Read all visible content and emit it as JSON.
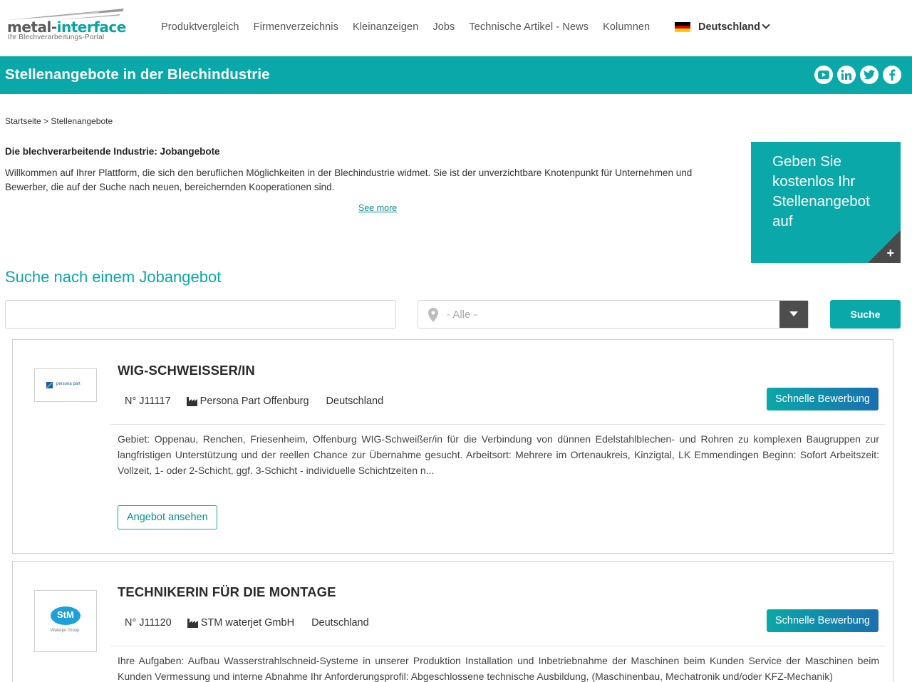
{
  "header": {
    "logo_main": "metal-",
    "logo_accent": "interface",
    "logo_tagline": "Ihr Blechverarbeitungs-Portal",
    "nav": [
      {
        "label": "Produktvergleich"
      },
      {
        "label": "Firmenverzeichnis"
      },
      {
        "label": "Kleinanzeigen"
      },
      {
        "label": "Jobs"
      },
      {
        "label": "Technische Artikel - News"
      },
      {
        "label": "Kolumnen"
      }
    ],
    "country": "Deutschland"
  },
  "band": {
    "title": "Stellenangebote in der Blechindustrie",
    "social_icons": [
      "youtube-icon",
      "linkedin-icon",
      "twitter-icon",
      "facebook-icon"
    ]
  },
  "breadcrumb": {
    "home": "Startseite",
    "separator": ">",
    "current": "Stellenangebote"
  },
  "intro": {
    "title": "Die blechverarbeitende Industrie: Jobangebote",
    "text": "Willkommen auf Ihrer Plattform, die sich den beruflichen Möglichkeiten in der Blechindustrie widmet. Sie ist der unverzichtbare Knotenpunkt für Unternehmen und Bewerber, die auf der Suche nach neuen, bereichernden Kooperationen sind.",
    "see_more": "See more"
  },
  "promo": {
    "text": "Geben Sie kostenlos Ihr Stellenangebot auf",
    "plus": "+"
  },
  "search": {
    "title": "Suche nach einem Jobangebot",
    "keyword_value": "",
    "location_value": "- Alle -",
    "button": "Suche"
  },
  "jobs": [
    {
      "title": "WIG-SCHWEISSER/IN",
      "number": "N° J11117",
      "company": "Persona Part Offenburg",
      "country": "Deutschland",
      "logo_text": "persona part",
      "quick_apply": "Schnelle Bewerbung",
      "description": "Gebiet: Oppenau, Renchen, Friesenheim, Offenburg WIG-Schweißer/in für die Verbindung von dünnen Edelstahlblechen- und Rohren zu komplexen Baugruppen zur langfristigen Unterstützung und der reellen Chance zur Übernahme gesucht. Arbeitsort: Mehrere im Ortenaukreis, Kinzigtal, LK Emmendingen Beginn: Sofort Arbeitszeit: Vollzeit, 1- oder 2-Schicht, ggf. 3-Schicht - individuelle Schichtzeiten n...",
      "view_offer": "Angebot ansehen"
    },
    {
      "title": "TECHNIKERIN FÜR DIE MONTAGE",
      "number": "N° J11120",
      "company": "STM waterjet GmbH",
      "country": "Deutschland",
      "logo_text": "StM",
      "logo_subtext": "Waterjet Group",
      "quick_apply": "Schnelle Bewerbung",
      "description": "Ihre Aufgaben: Aufbau Wasserstrahlschneid-Systeme in unserer Produktion Installation und Inbetriebnahme der Maschinen beim Kunden Service der Maschinen beim Kunden Vermessung und interne Abnahme Ihr Anforderungsprofil: Abgeschlossene technische Ausbildung, (Maschinenbau, Mechatronik und/oder KFZ-Mechanik)"
    }
  ],
  "colors": {
    "brand": "#0aa8a8",
    "dark": "#4d4d4d"
  }
}
